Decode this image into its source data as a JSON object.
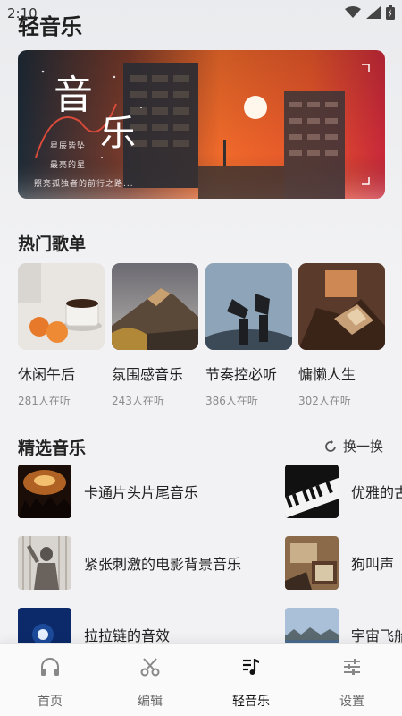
{
  "status_bar": {
    "time": "2:10",
    "time_suffix_icon": "notification-icon",
    "wifi_icon": "wifi-icon",
    "signal_icon": "signal-icon",
    "battery_icon": "battery-icon"
  },
  "header": {
    "title": "轻音乐"
  },
  "banner": {
    "word_1": "音",
    "word_2": "乐",
    "line_1": "星辰皆坠",
    "line_2": "最亮的星",
    "line_3": "照亮孤独者的前行之路..."
  },
  "hot_playlists": {
    "title": "热门歌单",
    "items": [
      {
        "name": "休闲午后",
        "listeners": "281人在听"
      },
      {
        "name": "氛围感音乐",
        "listeners": "243人在听"
      },
      {
        "name": "节奏控必听",
        "listeners": "386人在听"
      },
      {
        "name": "慵懒人生",
        "listeners": "302人在听"
      }
    ]
  },
  "featured": {
    "title": "精选音乐",
    "refresh_label": "换一换",
    "items": [
      {
        "title": "卡通片头片尾音乐"
      },
      {
        "title": "优雅的古"
      },
      {
        "title": "紧张刺激的电影背景音乐"
      },
      {
        "title": "狗叫声"
      },
      {
        "title": "拉拉链的音效"
      },
      {
        "title": "宇宙飞船"
      }
    ]
  },
  "bottom_nav": {
    "items": [
      {
        "label": "首页",
        "icon": "headphones-icon"
      },
      {
        "label": "编辑",
        "icon": "scissors-icon"
      },
      {
        "label": "轻音乐",
        "icon": "music-note-icon",
        "active": true
      },
      {
        "label": "设置",
        "icon": "sliders-icon"
      }
    ]
  },
  "colors": {
    "accent_text": "#222222",
    "muted_text": "#8a8a8a",
    "nav_bg": "#fafafa"
  }
}
